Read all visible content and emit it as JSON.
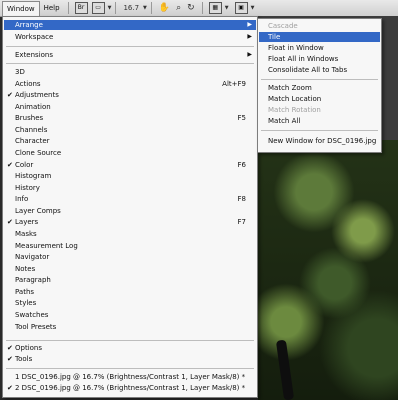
{
  "toolbar": {
    "menus": [
      "Window",
      "Help"
    ],
    "zoom": "16.7",
    "icons": [
      "br-icon",
      "frame-icon",
      "hand-icon",
      "zoom-icon",
      "rotate-icon",
      "arrange-docs-icon",
      "screen-mode-icon"
    ]
  },
  "window_menu": {
    "arrange": "Arrange",
    "workspace": "Workspace",
    "extensions": "Extensions",
    "panels": [
      {
        "label": "3D",
        "shortcut": "",
        "checked": false
      },
      {
        "label": "Actions",
        "shortcut": "Alt+F9",
        "checked": false
      },
      {
        "label": "Adjustments",
        "shortcut": "",
        "checked": true
      },
      {
        "label": "Animation",
        "shortcut": "",
        "checked": false
      },
      {
        "label": "Brushes",
        "shortcut": "F5",
        "checked": false
      },
      {
        "label": "Channels",
        "shortcut": "",
        "checked": false
      },
      {
        "label": "Character",
        "shortcut": "",
        "checked": false
      },
      {
        "label": "Clone Source",
        "shortcut": "",
        "checked": false
      },
      {
        "label": "Color",
        "shortcut": "F6",
        "checked": true
      },
      {
        "label": "Histogram",
        "shortcut": "",
        "checked": false
      },
      {
        "label": "History",
        "shortcut": "",
        "checked": false
      },
      {
        "label": "Info",
        "shortcut": "F8",
        "checked": false
      },
      {
        "label": "Layer Comps",
        "shortcut": "",
        "checked": false
      },
      {
        "label": "Layers",
        "shortcut": "F7",
        "checked": true
      },
      {
        "label": "Masks",
        "shortcut": "",
        "checked": false
      },
      {
        "label": "Measurement Log",
        "shortcut": "",
        "checked": false
      },
      {
        "label": "Navigator",
        "shortcut": "",
        "checked": false
      },
      {
        "label": "Notes",
        "shortcut": "",
        "checked": false
      },
      {
        "label": "Paragraph",
        "shortcut": "",
        "checked": false
      },
      {
        "label": "Paths",
        "shortcut": "",
        "checked": false
      },
      {
        "label": "Styles",
        "shortcut": "",
        "checked": false
      },
      {
        "label": "Swatches",
        "shortcut": "",
        "checked": false
      },
      {
        "label": "Tool Presets",
        "shortcut": "",
        "checked": false
      }
    ],
    "options": "Options",
    "tools": "Tools",
    "documents": [
      "1 DSC_0196.jpg @ 16.7% (Brightness/Contrast 1, Layer Mask/8) *",
      "2 DSC_0196.jpg @ 16.7% (Brightness/Contrast 1, Layer Mask/8) *"
    ]
  },
  "arrange_submenu": {
    "cascade": "Cascade",
    "tile": "Tile",
    "float_in_window": "Float in Window",
    "float_all": "Float All in Windows",
    "consolidate": "Consolidate All to Tabs",
    "match_zoom": "Match Zoom",
    "match_location": "Match Location",
    "match_rotation": "Match Rotation",
    "match_all": "Match All",
    "new_window": "New Window for DSC_0196.jpg"
  },
  "colors": {
    "highlight": "#3368c6",
    "menu_bg": "#f7f7f7",
    "disabled": "#a0a0a0"
  }
}
